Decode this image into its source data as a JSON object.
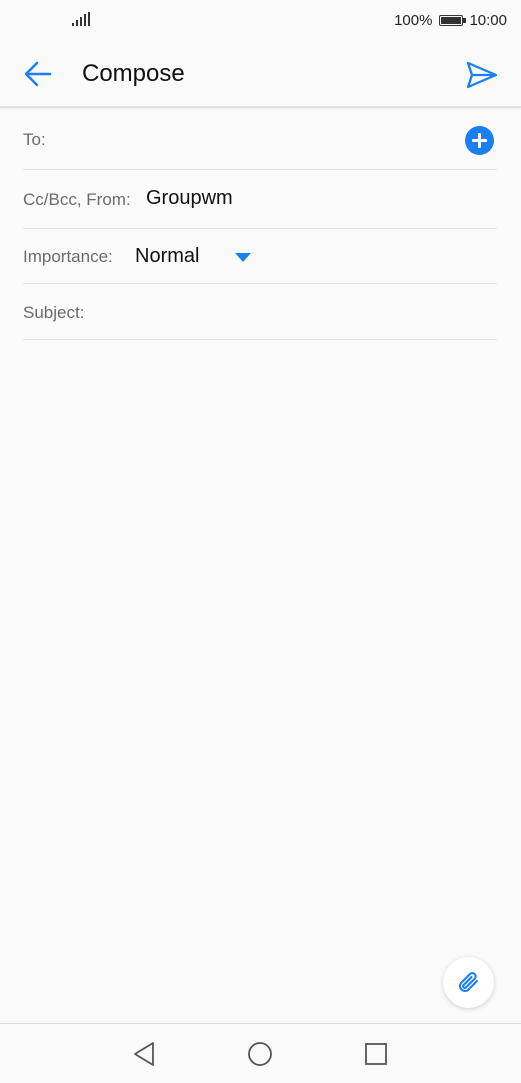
{
  "status_bar": {
    "battery_percent": "100%",
    "time": "10:00",
    "icons": [
      "signal-icon",
      "battery-icon"
    ]
  },
  "app_bar": {
    "title": "Compose",
    "back_icon": "arrow-left-icon",
    "send_icon": "send-icon"
  },
  "form": {
    "to_label": "To:",
    "to_value": "",
    "add_recipient_icon": "plus-circle-icon",
    "cc_bcc_from_label": "Cc/Bcc, From:",
    "from_value": "Groupwm",
    "importance_label": "Importance:",
    "importance_value": "Normal",
    "subject_label": "Subject:",
    "subject_value": "",
    "body_value": ""
  },
  "attach": {
    "icon": "paperclip-icon"
  },
  "nav_bar": {
    "icons": [
      "back-triangle-icon",
      "home-circle-icon",
      "recents-square-icon"
    ]
  },
  "colors": {
    "accent": "#1a7ff0",
    "background": "#fafafa",
    "divider": "#e2e2e2",
    "label": "#6b6b6b"
  }
}
